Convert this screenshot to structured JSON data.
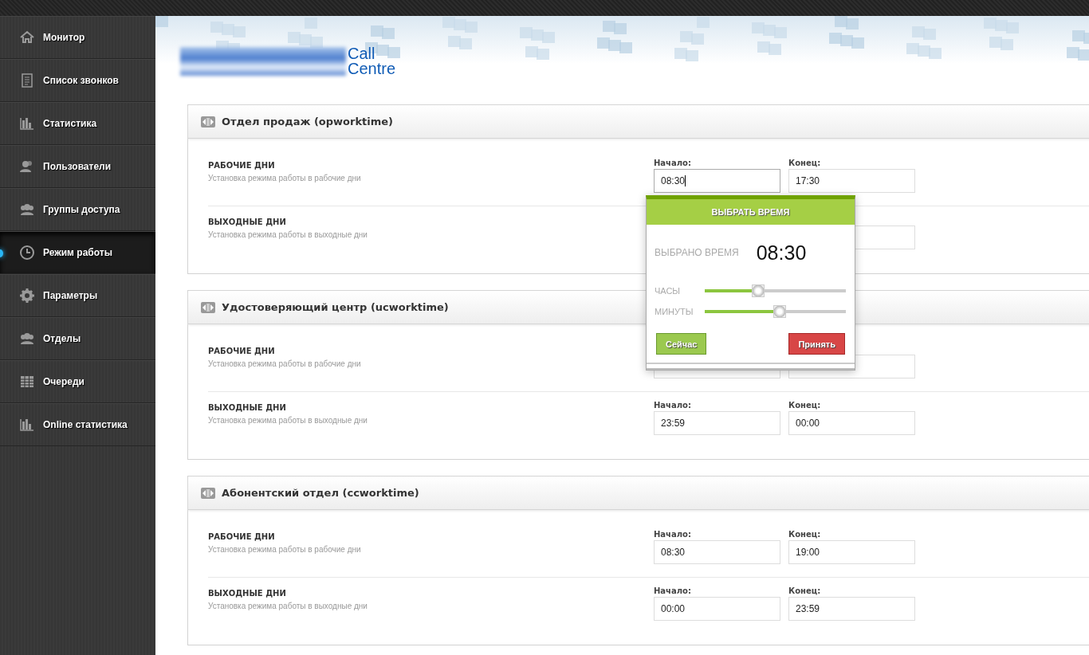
{
  "sidebar": {
    "items": [
      {
        "label": "Монитор",
        "selected": false
      },
      {
        "label": "Список звонков",
        "selected": false
      },
      {
        "label": "Статистика",
        "selected": false
      },
      {
        "label": "Пользователи",
        "selected": false
      },
      {
        "label": "Группы доступа",
        "selected": false
      },
      {
        "label": "Режим работы",
        "selected": true
      },
      {
        "label": "Параметры",
        "selected": false
      },
      {
        "label": "Отделы",
        "selected": false
      },
      {
        "label": "Очереди",
        "selected": false
      },
      {
        "label": "Online статистика",
        "selected": false
      }
    ]
  },
  "header": {
    "logo_text": [
      "Call",
      "Centre"
    ]
  },
  "sections": [
    {
      "title": "Отдел продаж (opworktime)",
      "rows": [
        {
          "title": "РАБОЧИЕ ДНИ",
          "description": "Установка режима работы в рабочие дни",
          "start": {
            "label": "Начало:",
            "value": "08:30",
            "focused": true
          },
          "end": {
            "label": "Конец:",
            "value": "17:30",
            "focused": false
          }
        },
        {
          "title": "ВЫХОДНЫЕ ДНИ",
          "description": "Установка режима работы в  выходные дни",
          "start": null,
          "end": {}
        }
      ]
    },
    {
      "title": "Удостоверяющий центр (ucworktime)",
      "rows": [
        {
          "title": "РАБОЧИЕ ДНИ",
          "description": "Установка режима работы в рабочие дни",
          "start": {},
          "end": {}
        },
        {
          "title": "ВЫХОДНЫЕ ДНИ",
          "description": "Установка режима работы в  выходные дни",
          "start": {
            "label": "Начало:",
            "value": "23:59",
            "focused": false
          },
          "end": {
            "label": "Конец:",
            "value": "00:00",
            "focused": false
          }
        }
      ]
    },
    {
      "title": "Абонентский отдел (ccworktime)",
      "rows": [
        {
          "title": "РАБОЧИЕ ДНИ",
          "description": "Установка режима работы в рабочие дни",
          "start": {
            "label": "Начало:",
            "value": "08:30",
            "focused": false
          },
          "end": {
            "label": "Конец:",
            "value": "19:00",
            "focused": false
          }
        },
        {
          "title": "ВЫХОДНЫЕ ДНИ",
          "description": "Установка режима работы в  выходные дни",
          "start": {
            "label": "Начало:",
            "value": "00:00",
            "focused": false
          },
          "end": {
            "label": "Конец:",
            "value": "23:59",
            "focused": false
          }
        }
      ]
    }
  ],
  "time_picker": {
    "title": "ВЫБРАТЬ ВРЕМЯ",
    "selected_label": "ВЫБРАНО ВРЕМЯ",
    "selected_time": "08:30",
    "sliders": [
      {
        "label": "ЧАСЫ",
        "level": 0.35
      },
      {
        "label": "МИНУТЫ",
        "level": 0.51
      }
    ],
    "buttons": [
      {
        "label": "Сейчас",
        "kind": "secondary"
      },
      {
        "label": "Принять",
        "kind": "primary"
      }
    ]
  }
}
